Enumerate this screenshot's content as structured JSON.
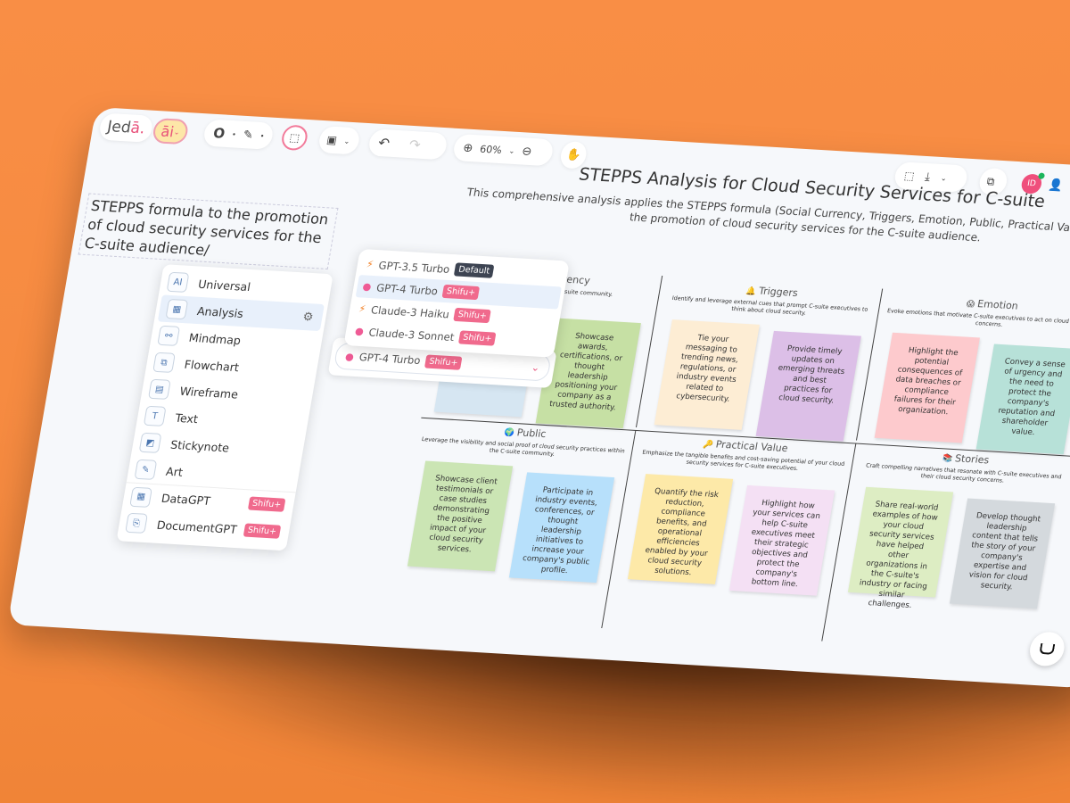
{
  "toolbar": {
    "logo": "Jed",
    "logo_accent": "ā.",
    "ai_label": "āi",
    "zoom_level": "60%"
  },
  "user": {
    "initials": "ID"
  },
  "board": {
    "title": "STEPPS Analysis for Cloud Security Services for C-suite",
    "subtitle": "This comprehensive analysis applies the STEPPS formula (Social Currency, Triggers, Emotion, Public, Practical Value, Stories) to the promotion of cloud security services for the C-suite audience."
  },
  "prompt_text": "STEPPS formula to the promotion of cloud security services for the C-suite audience/",
  "menu": {
    "items": [
      {
        "label": "Universal",
        "icon": "ai-icon",
        "glyph": "AI"
      },
      {
        "label": "Analysis",
        "icon": "analysis-grid-icon",
        "glyph": "▦",
        "active": true
      },
      {
        "label": "Mindmap",
        "icon": "mindmap-icon",
        "glyph": "⚯"
      },
      {
        "label": "Flowchart",
        "icon": "flowchart-icon",
        "glyph": "⧉"
      },
      {
        "label": "Wireframe",
        "icon": "wireframe-icon",
        "glyph": "▤"
      },
      {
        "label": "Text",
        "icon": "text-icon",
        "glyph": "T"
      },
      {
        "label": "Stickynote",
        "icon": "stickynote-icon",
        "glyph": "◩"
      },
      {
        "label": "Art",
        "icon": "palette-icon",
        "glyph": "✎"
      },
      {
        "label": "DataGPT",
        "icon": "datagpt-icon",
        "glyph": "▦",
        "badge": "Shifu+",
        "sep": true
      },
      {
        "label": "DocumentGPT",
        "icon": "documentgpt-icon",
        "glyph": "⎘",
        "badge": "Shifu+"
      }
    ]
  },
  "models": {
    "options": [
      {
        "label": "GPT-3.5 Turbo",
        "icon": "bolt",
        "badge": "Default"
      },
      {
        "label": "GPT-4 Turbo",
        "icon": "brain",
        "badge": "Shifu+",
        "selected": true
      },
      {
        "label": "Claude-3 Haiku",
        "icon": "bolt",
        "badge": "Shifu+"
      },
      {
        "label": "Claude-3 Sonnet",
        "icon": "brain",
        "badge": "Shifu+"
      }
    ],
    "current": {
      "label": "GPT-4 Turbo",
      "badge": "Shifu+"
    }
  },
  "grid": [
    {
      "title": "Social Currency",
      "emoji": "",
      "desc": "and belonging within the C-suite community.",
      "notes": [
        {
          "text": "",
          "color": "#d6e6f2"
        },
        {
          "text": "Showcase awards, certifications, or thought leadership positioning your company as a trusted authority.",
          "color": "#c6e0a4"
        }
      ]
    },
    {
      "title": "Triggers",
      "emoji": "🔔",
      "desc": "Identify and leverage external cues that prompt C-suite executives to think about cloud security.",
      "notes": [
        {
          "text": "Tie your messaging to trending news, regulations, or industry events related to cybersecurity.",
          "color": "#fdedd4"
        },
        {
          "text": "Provide timely updates on emerging threats and best practices for cloud security.",
          "color": "#dcbfe7"
        }
      ]
    },
    {
      "title": "Emotion",
      "emoji": "😱",
      "desc": "Evoke emotions that motivate C-suite executives to act on cloud security concerns.",
      "notes": [
        {
          "text": "Highlight the potential consequences of data breaches or compliance failures for their organization.",
          "color": "#fdcacd"
        },
        {
          "text": "Convey a sense of urgency and the need to protect the company's reputation and shareholder value.",
          "color": "#b7e1d8"
        }
      ]
    },
    {
      "title": "Public",
      "emoji": "🌍",
      "desc": "Leverage the visibility and social proof of cloud security practices within the C-suite community.",
      "notes": [
        {
          "text": "Showcase client testimonials or case studies demonstrating the positive impact of your cloud security services.",
          "color": "#cbe5b4"
        },
        {
          "text": "Participate in industry events, conferences, or thought leadership initiatives to increase your company's public profile.",
          "color": "#b7e0fb"
        }
      ]
    },
    {
      "title": "Practical Value",
      "emoji": "🔑",
      "desc": "Emphasize the tangible benefits and cost-saving potential of your cloud security services for C-suite executives.",
      "notes": [
        {
          "text": "Quantify the risk reduction, compliance benefits, and operational efficiencies enabled by your cloud security solutions.",
          "color": "#fde9a8"
        },
        {
          "text": "Highlight how your services can help C-suite executives meet their strategic objectives and protect the company's bottom line.",
          "color": "#f4e0f4"
        }
      ]
    },
    {
      "title": "Stories",
      "emoji": "📚",
      "desc": "Craft compelling narratives that resonate with C-suite executives and their cloud security concerns.",
      "notes": [
        {
          "text": "Share real-world examples of how your cloud security services have helped other organizations in the C-suite's industry or facing similar challenges.",
          "color": "#ddedc3"
        },
        {
          "text": "Develop thought leadership content that tells the story of your company's expertise and vision for cloud security.",
          "color": "#d4d9dd"
        }
      ]
    }
  ],
  "colors": {
    "accent": "#e8507a",
    "background": "#f58a40",
    "canvas": "#f6f8fb"
  }
}
